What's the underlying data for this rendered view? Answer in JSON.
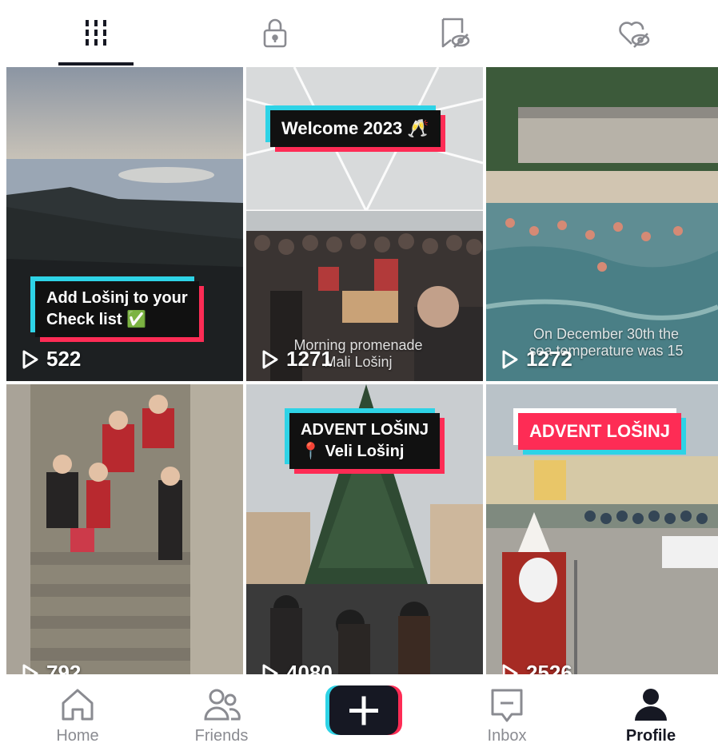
{
  "tabs": [
    {
      "name": "videos",
      "icon": "grid-icon",
      "active": true
    },
    {
      "name": "private",
      "icon": "lock-icon",
      "active": false
    },
    {
      "name": "favorites",
      "icon": "bookmark-hidden-icon",
      "active": false
    },
    {
      "name": "liked",
      "icon": "heart-hidden-icon",
      "active": false
    }
  ],
  "videos": [
    {
      "label_lines": [
        "Add Lošinj to your",
        "Check list ✅"
      ],
      "views": "522"
    },
    {
      "label": "Welcome 2023 🥂",
      "caption": [
        "Morning promenade",
        "Mali Lošinj"
      ],
      "views": "1271"
    },
    {
      "caption": [
        "On December 30th the",
        "sea temperature was 15"
      ],
      "views": "1272"
    },
    {
      "views": "792"
    },
    {
      "label_lines": [
        "ADVENT LOŠINJ",
        "📍 Veli Lošinj"
      ],
      "views": "4080"
    },
    {
      "label": "ADVENT LOŠINJ",
      "views": "2526"
    }
  ],
  "nav": {
    "home": "Home",
    "friends": "Friends",
    "create": "+",
    "inbox": "Inbox",
    "profile": "Profile"
  },
  "colors": {
    "accent_pink": "#fe2c55",
    "accent_cyan": "#2ed3e6",
    "text_dark": "#161823",
    "text_muted": "#8a8b91"
  }
}
